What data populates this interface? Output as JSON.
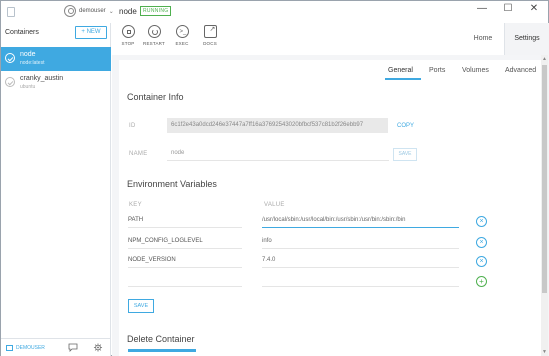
{
  "titlebar": {
    "user_name": "demouser",
    "container_name": "node",
    "status_badge": "RUNNING",
    "window_controls": {
      "minimize": "—",
      "maximize": "☐",
      "close": "✕"
    }
  },
  "sidebar": {
    "title": "Containers",
    "new_button": "+ NEW",
    "items": [
      {
        "name": "node",
        "image": "node:latest",
        "active": true
      },
      {
        "name": "cranky_austin",
        "image": "ubuntu",
        "active": false
      }
    ],
    "bottom_user": "DEMOUSER"
  },
  "toolbar": {
    "buttons": [
      {
        "label": "STOP",
        "icon": "stop-icon"
      },
      {
        "label": "RESTART",
        "icon": "restart-icon"
      },
      {
        "label": "EXEC",
        "icon": "exec-icon"
      },
      {
        "label": "DOCS",
        "icon": "docs-icon"
      }
    ]
  },
  "right_tabs": {
    "home": "Home",
    "settings": "Settings",
    "active": "Settings"
  },
  "subtabs": {
    "general": "General",
    "ports": "Ports",
    "volumes": "Volumes",
    "advanced": "Advanced",
    "active": "General"
  },
  "container_info": {
    "title": "Container Info",
    "id_label": "ID",
    "id_value": "6c1f2e43a0dcd246e37447a7ff16a37692543020bfbcf537c81b2f26ebb97",
    "copy_label": "COPY",
    "name_label": "NAME",
    "name_value": "node",
    "save_label": "SAVE"
  },
  "env": {
    "title": "Environment Variables",
    "key_header": "KEY",
    "value_header": "VALUE",
    "rows": [
      {
        "key": "PATH",
        "value": "/usr/local/sbin:/usr/local/bin:/usr/sbin:/usr/bin:/sbin:/bin"
      },
      {
        "key": "NPM_CONFIG_LOGLEVEL",
        "value": "info"
      },
      {
        "key": "NODE_VERSION",
        "value": "7.4.0"
      },
      {
        "key": "",
        "value": ""
      }
    ],
    "save_label": "SAVE"
  },
  "delete": {
    "title": "Delete Container"
  },
  "colors": {
    "accent": "#3fa9e1",
    "running": "#4fb04f"
  }
}
